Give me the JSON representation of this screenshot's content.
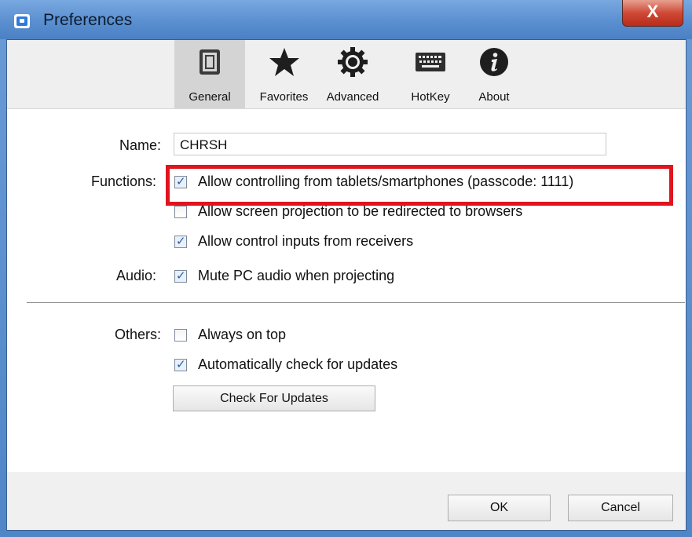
{
  "window": {
    "title": "Preferences",
    "close_glyph": "X"
  },
  "toolbar": {
    "tabs": [
      {
        "label": "General",
        "icon": "general-icon",
        "selected": true
      },
      {
        "label": "Favorites",
        "icon": "star-icon",
        "selected": false
      },
      {
        "label": "Advanced",
        "icon": "gear-icon",
        "selected": false
      },
      {
        "label": "HotKey",
        "icon": "keyboard-icon",
        "selected": false
      },
      {
        "label": "About",
        "icon": "info-icon",
        "selected": false
      }
    ]
  },
  "form": {
    "name_label": "Name:",
    "name_value": "CHRSH",
    "functions_label": "Functions:",
    "functions": [
      {
        "label": "Allow controlling from tablets/smartphones (passcode: 1111)",
        "checked": true
      },
      {
        "label": "Allow screen projection to be redirected to browsers",
        "checked": false
      },
      {
        "label": "Allow control inputs from receivers",
        "checked": true
      }
    ],
    "audio_label": "Audio:",
    "audio_option": {
      "label": "Mute PC audio when projecting",
      "checked": true
    },
    "others_label": "Others:",
    "others": [
      {
        "label": "Always on top",
        "checked": false
      },
      {
        "label": "Automatically check for updates",
        "checked": true
      }
    ],
    "check_updates_button": "Check For Updates"
  },
  "footer": {
    "ok_label": "OK",
    "cancel_label": "Cancel"
  },
  "colors": {
    "highlight": "#e0141e",
    "titlebar": "#5a8fd0",
    "checkmark": "#2b5fa8"
  }
}
